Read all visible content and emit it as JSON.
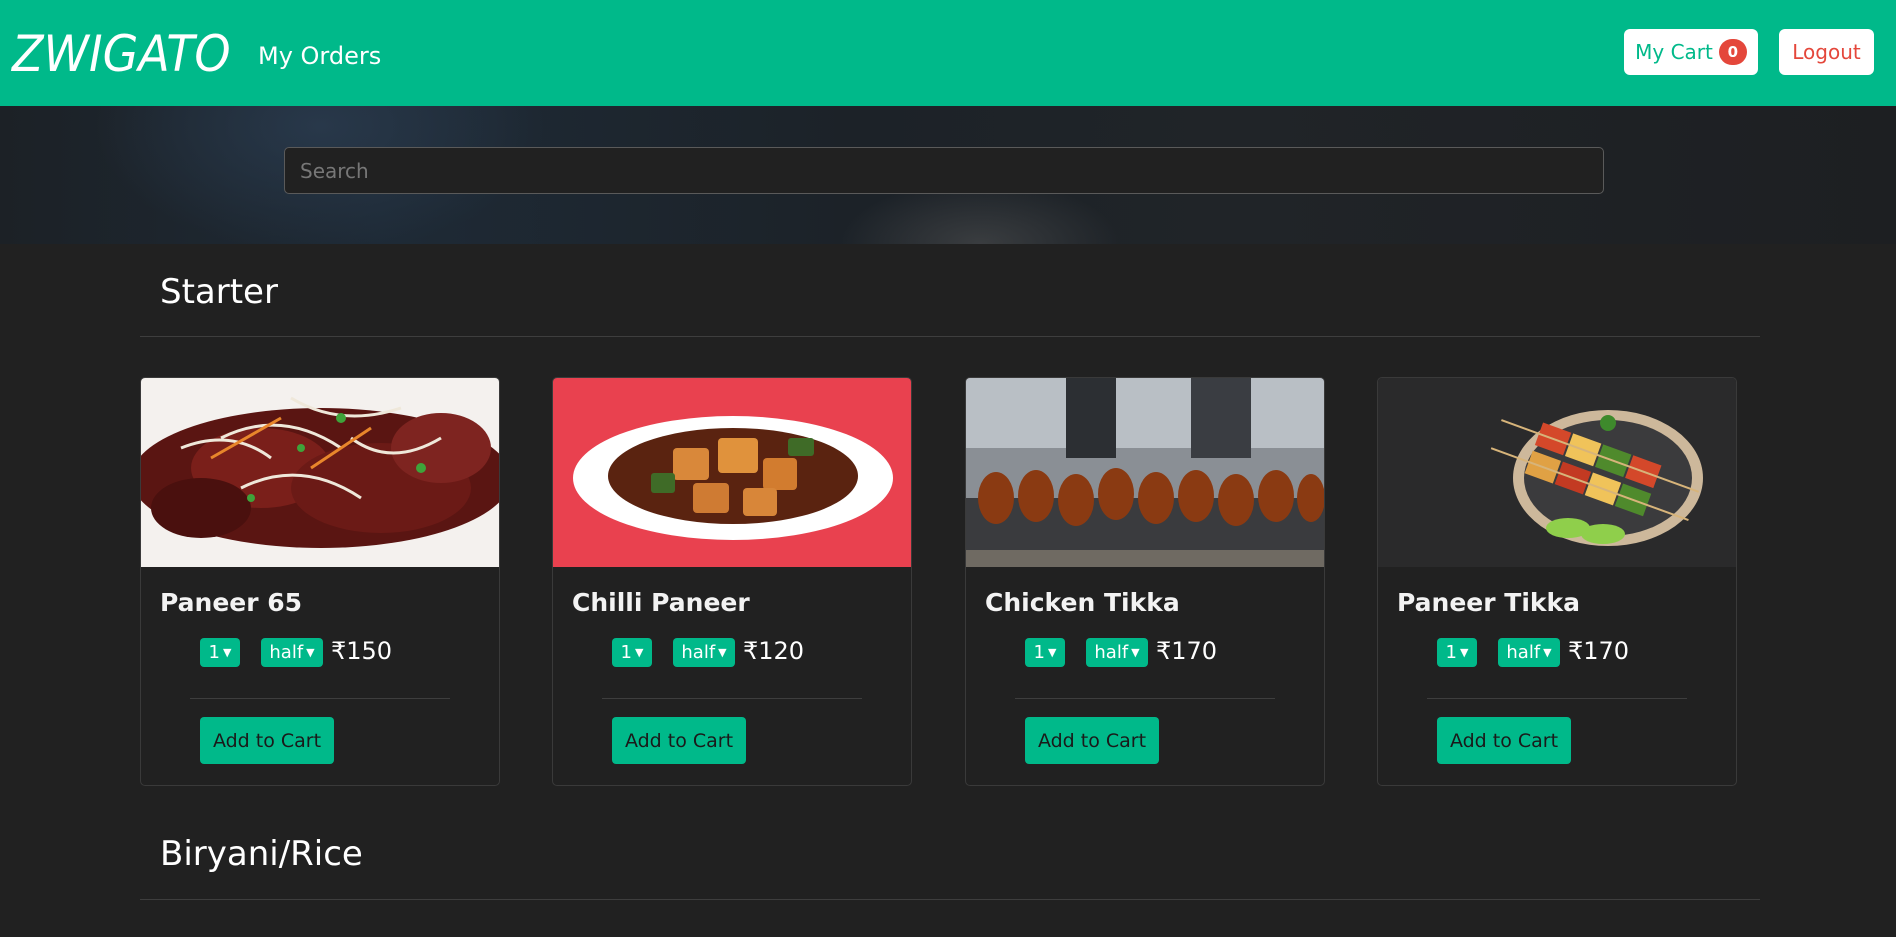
{
  "navbar": {
    "brand": "ZWIGATO",
    "my_orders": "My Orders",
    "cart_label": "My Cart",
    "cart_count": "0",
    "logout": "Logout",
    "accent": "#00b98a"
  },
  "search": {
    "placeholder": "Search"
  },
  "sections": [
    {
      "title": "Starter",
      "items": [
        {
          "name": "Paneer 65",
          "qty": "1",
          "size": "half",
          "price": "₹150",
          "add_label": "Add to Cart"
        },
        {
          "name": "Chilli Paneer",
          "qty": "1",
          "size": "half",
          "price": "₹120",
          "add_label": "Add to Cart"
        },
        {
          "name": "Chicken Tikka",
          "qty": "1",
          "size": "half",
          "price": "₹170",
          "add_label": "Add to Cart"
        },
        {
          "name": "Paneer Tikka",
          "qty": "1",
          "size": "half",
          "price": "₹170",
          "add_label": "Add to Cart"
        }
      ]
    },
    {
      "title": "Biryani/Rice"
    }
  ]
}
